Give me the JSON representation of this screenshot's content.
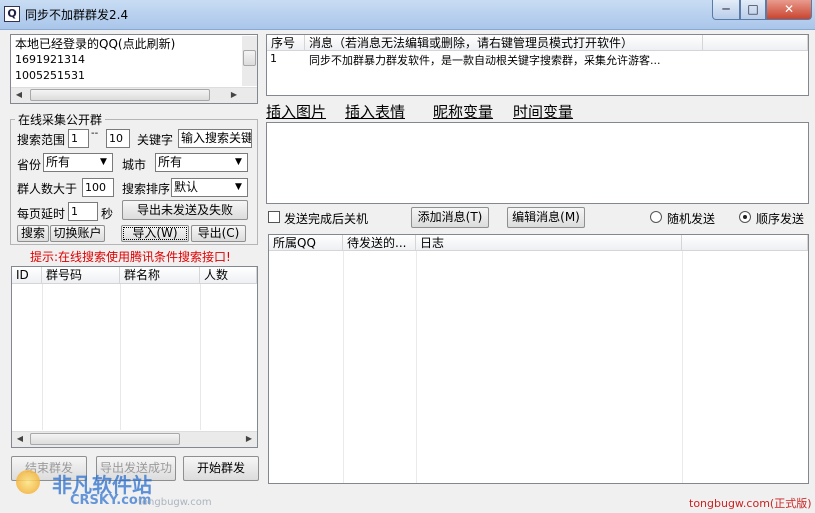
{
  "window": {
    "title": "同步不加群群发2.4",
    "icon_glyph": "Q",
    "min_glyph": "─",
    "max_glyph": "□",
    "close_glyph": "✕"
  },
  "accounts": {
    "header": "本地已经登录的QQ(点此刷新)",
    "items": [
      "1691921314",
      "1005251531"
    ]
  },
  "search": {
    "group_title": "在线采集公开群",
    "range_label": "搜索范围",
    "range_from": "1",
    "range_sep": "--",
    "range_to": "10",
    "keyword_label": "关键字",
    "keyword_placeholder": "输入搜索关键",
    "province_label": "省份",
    "province_value": "所有",
    "city_label": "城市",
    "city_value": "所有",
    "min_members_label": "群人数大于",
    "min_members_value": "100",
    "sort_label": "搜索排序",
    "sort_value": "默认",
    "delay_label": "每页延时",
    "delay_value": "1",
    "delay_unit": "秒",
    "export_failed_btn": "导出未发送及失败",
    "search_btn": "搜索",
    "switch_btn": "切换账户",
    "import_btn": "导入(W)",
    "export_btn": "导出(C)",
    "hint": "提示:在线搜索使用腾讯条件搜索接口!"
  },
  "group_table": {
    "columns": [
      "ID",
      "群号码",
      "群名称",
      "人数"
    ]
  },
  "bottom_buttons": {
    "stop": "结束群发",
    "export_success": "导出发送成功",
    "start": "开始群发"
  },
  "messages": {
    "columns": [
      "序号",
      "消息（若消息无法编辑或删除，请右键管理员模式打开软件）"
    ],
    "rows": [
      {
        "no": "1",
        "text": "同步不加群暴力群发软件，是一款自动根关键字搜索群，采集允许游客..."
      }
    ]
  },
  "insert_links": [
    "插入图片",
    "插入表情",
    "昵称变量",
    "时间变量"
  ],
  "options": {
    "shutdown_label": "发送完成后关机",
    "add_msg_btn": "添加消息(T)",
    "edit_msg_btn": "编辑消息(M)",
    "random_label": "随机发送",
    "order_label": "顺序发送",
    "selected_mode": "顺序发送"
  },
  "log_table": {
    "columns": [
      "所属QQ",
      "待发送的...",
      "日志"
    ]
  },
  "footer": {
    "site_text": "tongbugw.com(正式版)",
    "watermark_brand": "非凡软件站",
    "watermark_sub": "CRSKY.com",
    "watermark_url": "tongbugw.com"
  },
  "colors": {
    "hint_red": "#e00000",
    "footer_red": "#cc2222",
    "titlebar": "#b8d0ee"
  }
}
